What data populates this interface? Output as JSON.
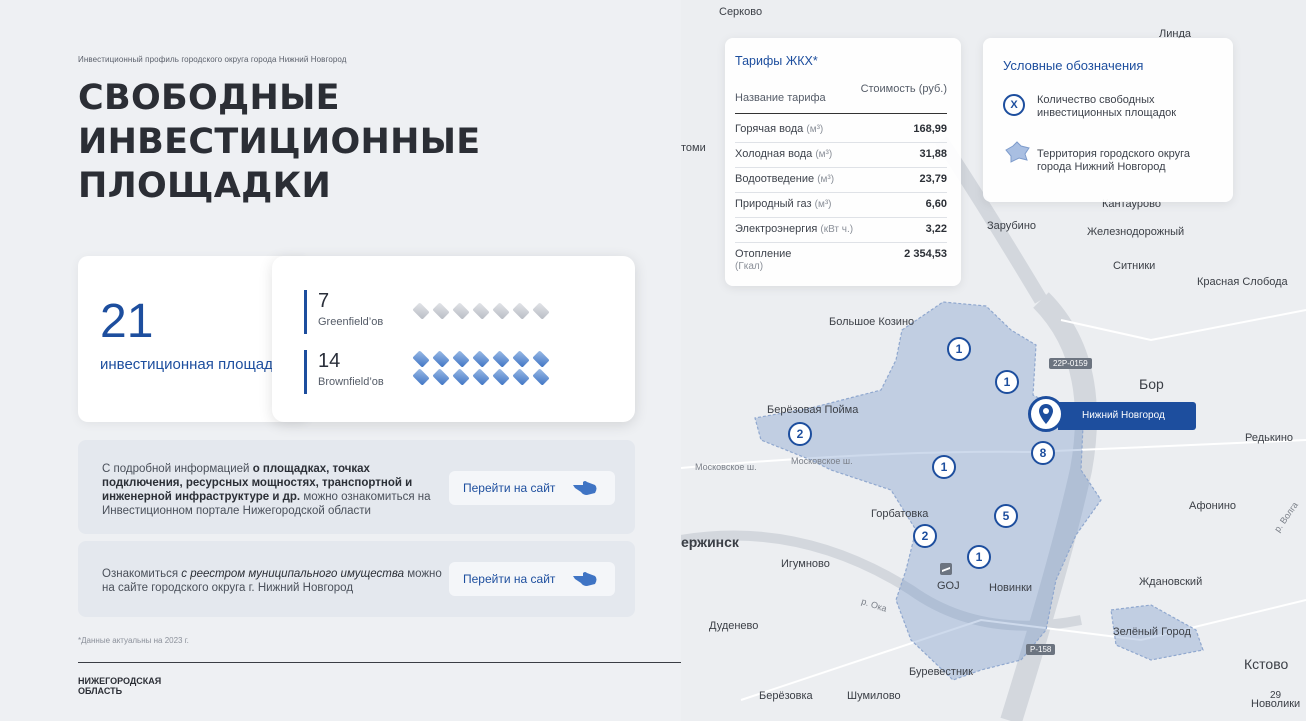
{
  "kicker": "Инвестиционный профиль городского округа города Нижний Новгород",
  "title": "СВОБОДНЫЕ ИНВЕСТИЦИОННЫЕ ПЛОЩАДКИ",
  "summary": {
    "count": "21",
    "count_label": "инвестиционная площадка",
    "greenfield": {
      "count": "7",
      "label": "Greenfield’ов",
      "icons": 7
    },
    "brownfield": {
      "count": "14",
      "label": "Brownfield’ов",
      "icons": 14
    }
  },
  "info_block_1": {
    "text_plain_1": "С подробной информацией ",
    "text_bold": "о площадках, точках подключения, ресурсных мощностях, транспортной и инженерной инфраструктуре и др.",
    "text_plain_2": " можно ознакомиться на Инвестиционном портале Нижегородской области",
    "button": "Перейти на сайт"
  },
  "info_block_2": {
    "text_plain_1": "Ознакомиться ",
    "text_italic": "с реестром муниципального имущества",
    "text_plain_2": " можно на сайте городского округа г. Нижний Новгород",
    "button": "Перейти на сайт"
  },
  "footnote": "*Данные актуальны на 2023 г.",
  "region_logo": "НИЖЕГОРОДСКАЯ ОБЛАСТЬ",
  "tariffs": {
    "title": "Тарифы ЖКХ*",
    "header_name": "Название тарифа",
    "header_cost": "Стоимость (руб.)",
    "rows": [
      {
        "name": "Горячая вода",
        "unit": "(м³)",
        "value": "168,99"
      },
      {
        "name": "Холодная вода",
        "unit": "(м³)",
        "value": "31,88"
      },
      {
        "name": "Водоотведение",
        "unit": "(м³)",
        "value": "23,79"
      },
      {
        "name": "Природный газ",
        "unit": "(м³)",
        "value": "6,60"
      },
      {
        "name": "Электроэнергия",
        "unit": "(кВт ч.)",
        "value": "3,22"
      },
      {
        "name": "Отопление",
        "unit": "(Гкал)",
        "value": "2 354,53"
      }
    ]
  },
  "legend": {
    "title": "Условные обозначения",
    "marker_symbol": "X",
    "marker_text": "Количество свободных инвестиционных площадок",
    "territory_text": "Территория городского округа города Нижний Новгород"
  },
  "map": {
    "city_label": "Нижний Новгород",
    "markers": [
      "1",
      "1",
      "2",
      "8",
      "1",
      "5",
      "2",
      "1"
    ],
    "labels": {
      "serkovo": "Серково",
      "linda": "Линда",
      "kantaurovo": "Кантаурово",
      "zarubino": "Зарубино",
      "zheleznodorozhny": "Железнодорожный",
      "sitniki": "Ситники",
      "krasnaya_sloboda": "Красная Слобода",
      "bolshoe_kozino": "Большое Козино",
      "bor": "Бор",
      "beryozovaya_poyma": "Берёзовая Пойма",
      "redkino": "Редькино",
      "moskovskoe_sh_1": "Московское ш.",
      "moskovskoe_sh_2": "Московское ш.",
      "gorbatovka": "Горбатовка",
      "afonino": "Афонино",
      "dzerzhinsk": "ержинск",
      "igumnovo": "Игумново",
      "zhdanovsky": "Ждановский",
      "novinki": "Новинки",
      "goj": "GOJ",
      "oka": "р. Ока",
      "volga": "р. Волга",
      "dudenevo": "Дуденево",
      "zeleny_gorod": "Зелёный Город",
      "kstovo": "Кстово",
      "burevestnik": "Буревестник",
      "beryozovka": "Берёзовка",
      "shumilovo": "Шумилово",
      "novoliki": "Новолики",
      "tomi": "томи",
      "road_1": "22Р-0159",
      "road_2": "Р-158"
    }
  },
  "page_number": "29"
}
